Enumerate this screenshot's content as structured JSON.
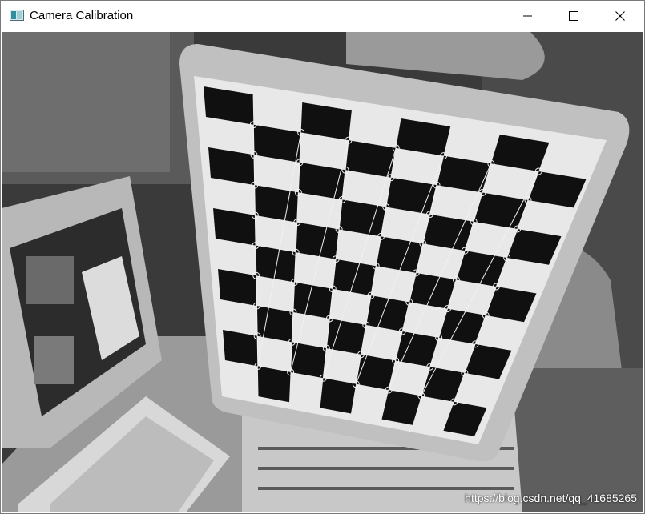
{
  "window": {
    "title": "Camera Calibration",
    "controls": {
      "minimize": "minimize",
      "maximize": "maximize",
      "close": "close"
    }
  },
  "image": {
    "description_icon": "camera-frame",
    "watermark": "https://blog.csdn.net/qq_41685265"
  },
  "colors": {
    "titlebar_bg": "#ffffff",
    "board_black": "#101010",
    "board_white": "#e8e8e8",
    "corner_marker": "#f0f0f0"
  }
}
